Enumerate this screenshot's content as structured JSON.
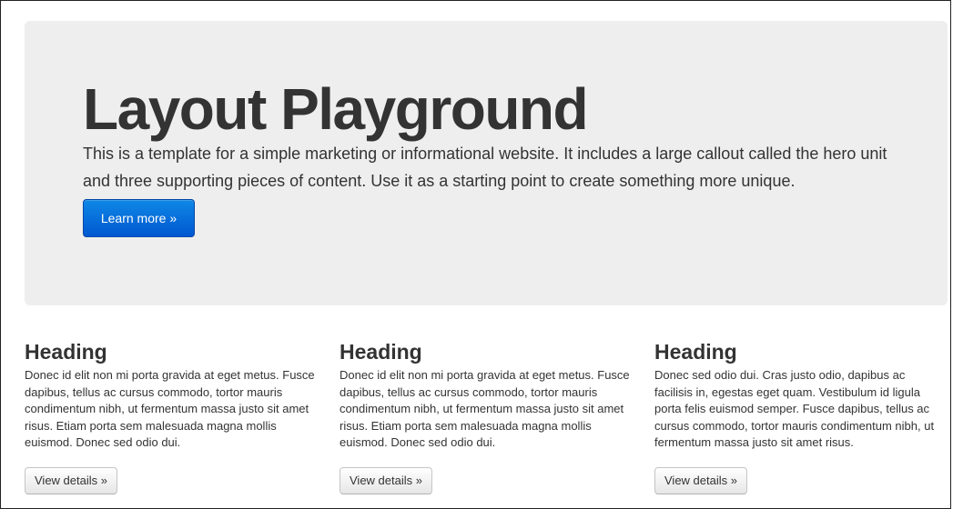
{
  "hero": {
    "title": "Layout Playground",
    "text": "This is a template for a simple marketing or informational website. It includes a large callout called the hero unit and three supporting pieces of content. Use it as a starting point to create something more unique.",
    "button_label": "Learn more »"
  },
  "columns": [
    {
      "heading": "Heading",
      "body": "Donec id elit non mi porta gravida at eget metus. Fusce dapibus, tellus ac cursus commodo, tortor mauris condimentum nibh, ut fermentum massa justo sit amet risus. Etiam porta sem malesuada magna mollis euismod. Donec sed odio dui.",
      "button_label": "View details »"
    },
    {
      "heading": "Heading",
      "body": "Donec id elit non mi porta gravida at eget metus. Fusce dapibus, tellus ac cursus commodo, tortor mauris condimentum nibh, ut fermentum massa justo sit amet risus. Etiam porta sem malesuada magna mollis euismod. Donec sed odio dui.",
      "button_label": "View details »"
    },
    {
      "heading": "Heading",
      "body": "Donec sed odio dui. Cras justo odio, dapibus ac facilisis in, egestas eget quam. Vestibulum id ligula porta felis euismod semper. Fusce dapibus, tellus ac cursus commodo, tortor mauris condimentum nibh, ut fermentum massa justo sit amet risus.",
      "button_label": "View details »"
    }
  ],
  "colors": {
    "hero_background": "#eeeeee",
    "primary_button": "#0068d8",
    "text": "#333333"
  }
}
